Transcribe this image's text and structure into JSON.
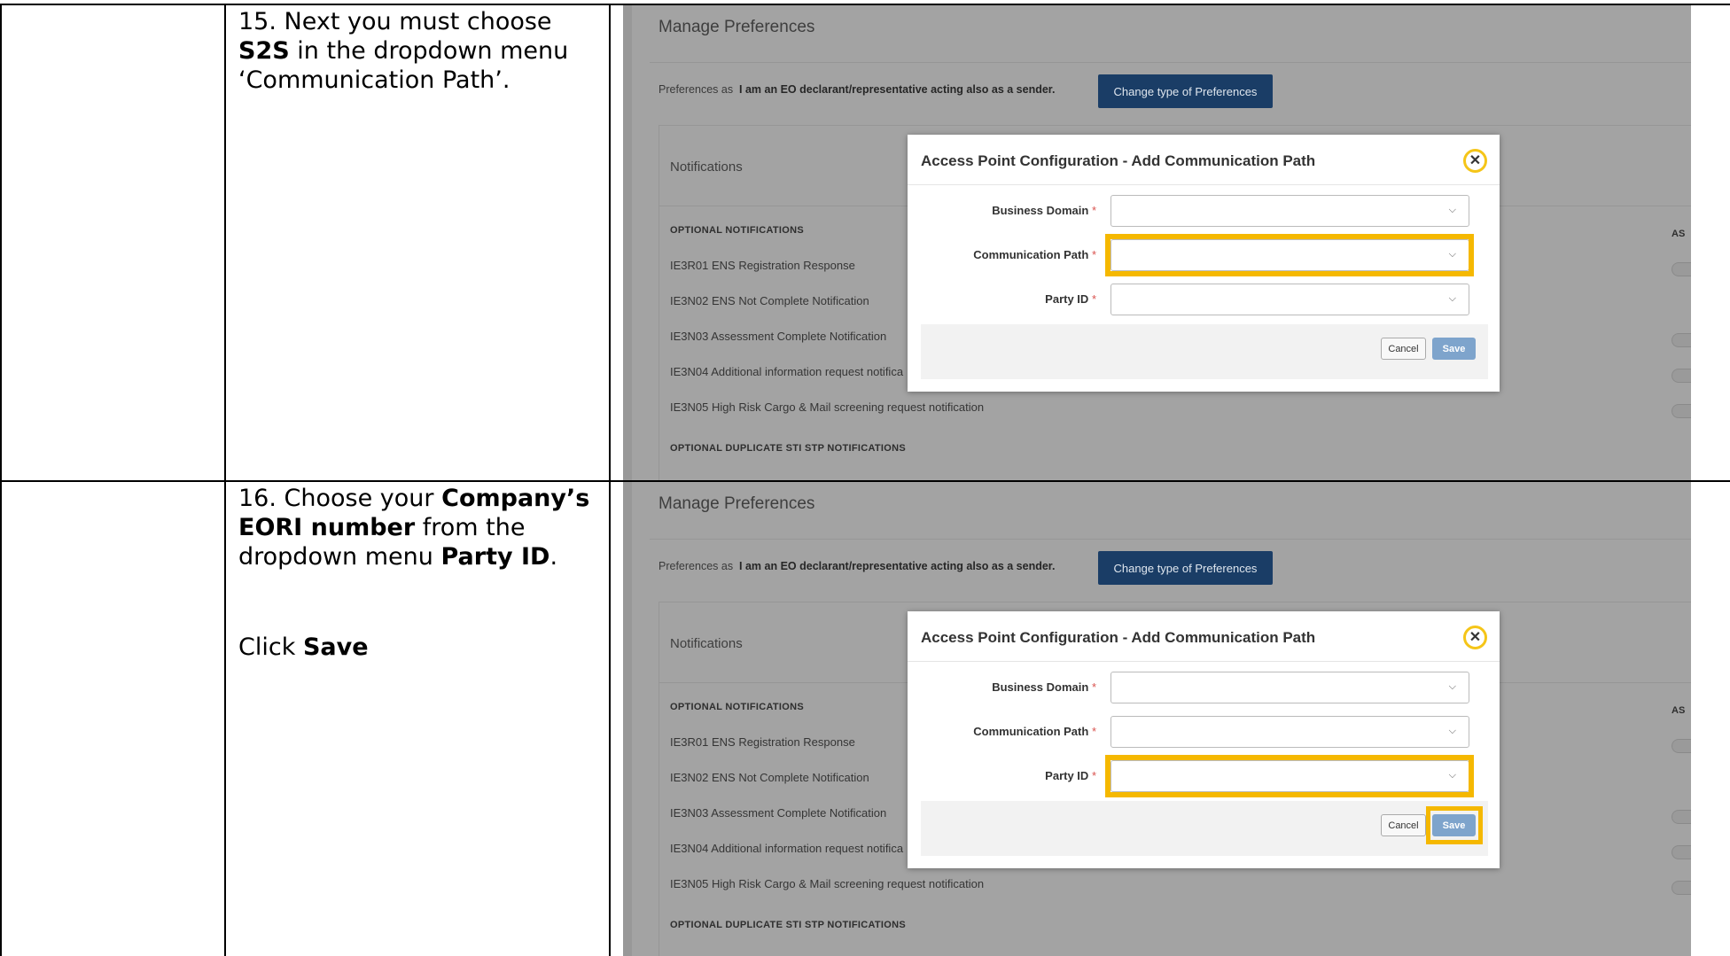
{
  "steps": [
    {
      "number": "15.",
      "text_a": "Next you must choose",
      "bold_a": "S2S",
      "text_b": "in the dropdown menu ‘Communication Path’."
    },
    {
      "number": "16.",
      "text_a": "Choose your",
      "bold_a": "Company’s EORI number",
      "text_b": "from the dropdown menu",
      "bold_b": "Party ID",
      "text_c": ".",
      "click_text": "Click",
      "click_bold": "Save"
    }
  ],
  "screenshot": {
    "page_title": "Manage Preferences",
    "preferences_prefix": "Preferences as",
    "preferences_type": "I am an EO declarant/representative acting also as a sender.",
    "change_button": "Change type of Preferences",
    "notifications_title": "Notifications",
    "section_optional": "OPTIONAL NOTIFICATIONS",
    "column_as": "AS",
    "notifications": [
      "IE3R01 ENS Registration Response",
      "IE3N02 ENS Not Complete Notification",
      "IE3N03 Assessment Complete Notification",
      "IE3N04 Additional information request notifica",
      "IE3N05 High Risk Cargo & Mail screening request notification"
    ],
    "section_duplicate": "OPTIONAL DUPLICATE STI STP NOTIFICATIONS",
    "modal": {
      "title": "Access Point Configuration - Add Communication Path",
      "close_icon": "close-icon",
      "fields": [
        "Business Domain",
        "Communication Path",
        "Party ID"
      ],
      "required_mark": "*",
      "cancel": "Cancel",
      "save": "Save"
    },
    "highlight_color": "#f5b800"
  }
}
